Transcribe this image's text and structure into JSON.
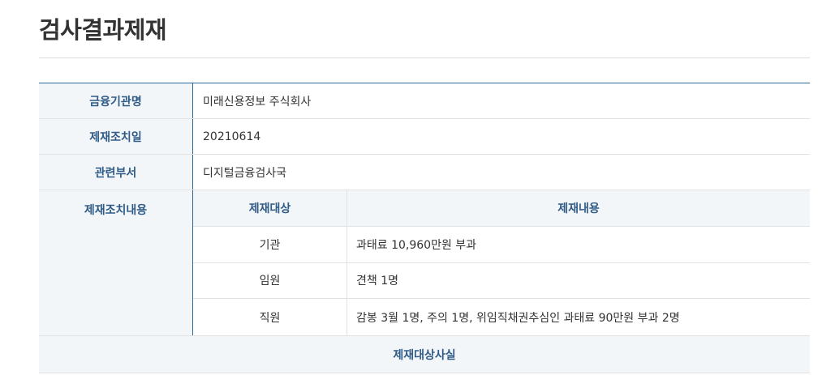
{
  "page": {
    "title": "검사결과제재"
  },
  "info": {
    "institution_label": "금융기관명",
    "institution_value": "미래신용정보 주식회사",
    "date_label": "제재조치일",
    "date_value": "20210614",
    "dept_label": "관련부서",
    "dept_value": "디지털금융검사국",
    "sanction_label": "제재조치내용"
  },
  "sanctions": {
    "headers": {
      "target": "제재대상",
      "content": "제재내용"
    },
    "rows": [
      {
        "target": "기관",
        "content": "과태료 10,960만원 부과"
      },
      {
        "target": "임원",
        "content": "견책 1명"
      },
      {
        "target": "직원",
        "content": "감봉 3월 1명, 주의 1명, 위임직채권추심인 과태료 90만원 부과 2명"
      }
    ]
  },
  "facts": {
    "label": "제재대상사실"
  },
  "colors": {
    "accent": "#2f6a9c",
    "header_bg": "#f3f6f9",
    "label_text": "#2f5b86"
  }
}
